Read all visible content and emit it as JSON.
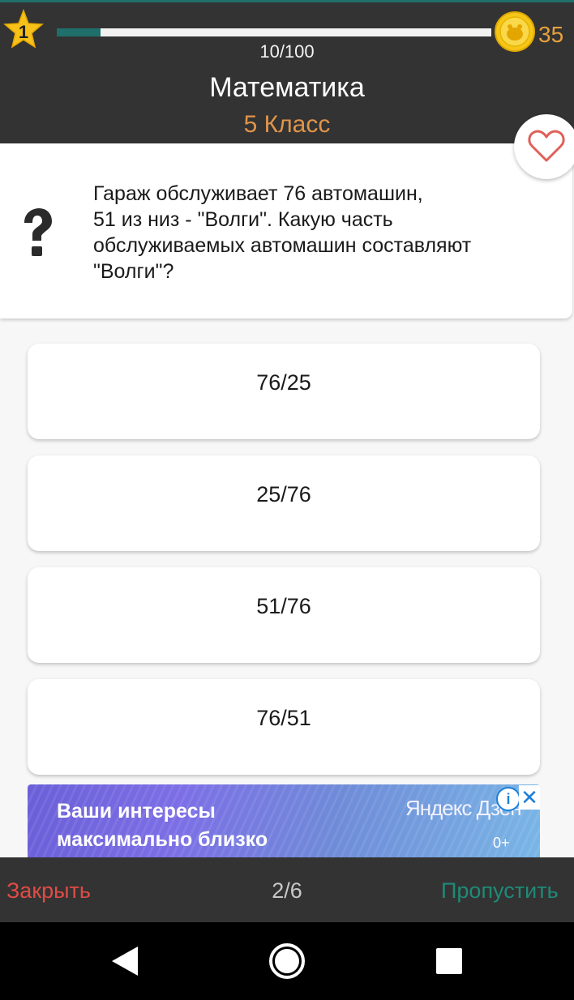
{
  "header": {
    "level": "1",
    "progress": {
      "current": 10,
      "total": 100,
      "text": "10/100",
      "fraction": 0.1
    },
    "coins": "35",
    "subject": "Математика",
    "grade": "5 Класс"
  },
  "question": {
    "lines": [
      "Гараж обслуживает 76 автомашин,",
      "51 из низ - \"Волги\". Какую часть",
      "обслуживаемых автомашин составляют",
      "\"Волги\"?"
    ]
  },
  "answers": [
    "76/25",
    "25/76",
    "51/76",
    "76/51"
  ],
  "ad": {
    "headline_line1": "Ваши интересы",
    "headline_line2": "максимально близко",
    "brand": "Яндекс Дзен",
    "age": "0+",
    "info_label": "i",
    "close_label": "✕"
  },
  "bottom": {
    "close_label": "Закрыть",
    "page": "2/6",
    "skip_label": "Пропустить"
  },
  "colors": {
    "header_bg": "#333333",
    "progress_fill": "#1f6f6a",
    "coin": "#f5c518",
    "grade": "#e0954a",
    "close": "#e24b45",
    "skip": "#1f8a77"
  },
  "icons": {
    "level": "star-icon",
    "coins": "coin-icon",
    "favorite": "heart-icon",
    "question": "question-mark-icon",
    "nav_back": "back-triangle-icon",
    "nav_home": "home-circle-icon",
    "nav_recent": "recent-square-icon"
  }
}
